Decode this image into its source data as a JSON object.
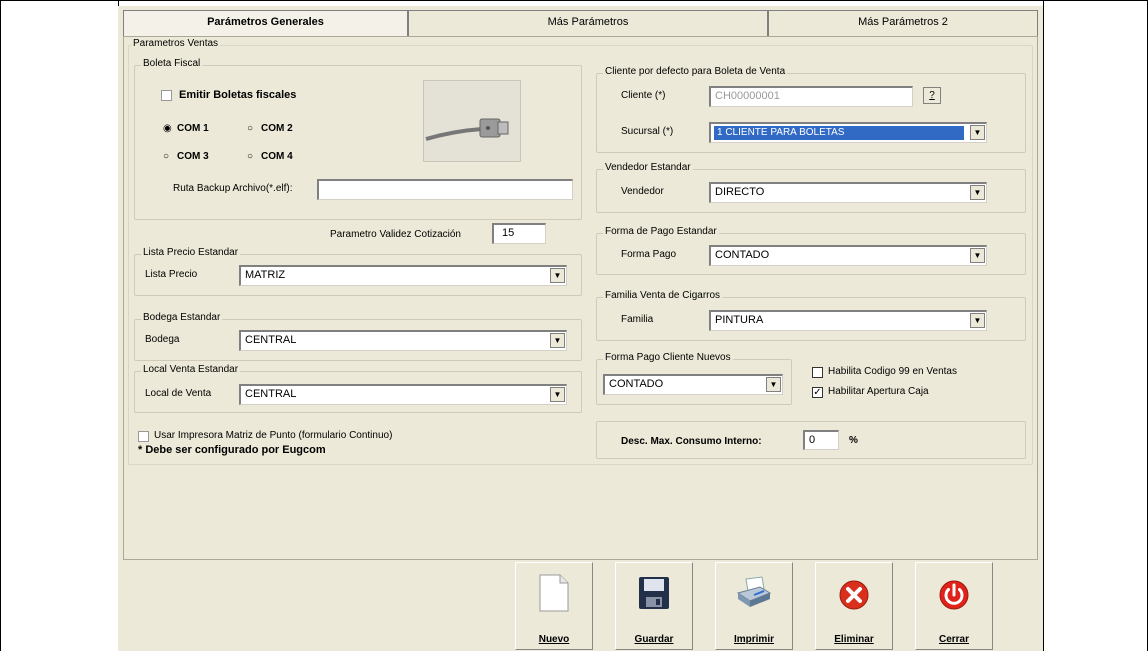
{
  "tabs": [
    {
      "label": "Parámetros Generales",
      "active": true
    },
    {
      "label": "Más Parámetros",
      "active": false
    },
    {
      "label": "Más Parámetros 2",
      "active": false
    }
  ],
  "parametros_ventas": {
    "legend": "Parametros Ventas",
    "boleta_fiscal": {
      "legend": "Boleta Fiscal",
      "emitir_label": "Emitir Boletas fiscales",
      "emitir_checked": false,
      "ports": [
        {
          "label": "COM 1",
          "selected": true
        },
        {
          "label": "COM 2",
          "selected": false
        },
        {
          "label": "COM 3",
          "selected": false
        },
        {
          "label": "COM 4",
          "selected": false
        }
      ],
      "ruta_label": "Ruta Backup Archivo(*.elf):",
      "ruta_value": ""
    },
    "validez_label": "Parametro Validez Cotización",
    "validez_value": "15",
    "lista_precio": {
      "legend": "Lista Precio Estandar",
      "label": "Lista Precio",
      "value": "MATRIZ"
    },
    "bodega": {
      "legend": "Bodega Estandar",
      "label": "Bodega",
      "value": "CENTRAL"
    },
    "local_venta": {
      "legend": "Local Venta Estandar",
      "label": "Local de Venta",
      "value": "CENTRAL"
    },
    "impresora_label": "Usar Impresora Matriz de Punto (formulario Continuo)",
    "impresora_checked": false,
    "eugcom_note": "* Debe ser configurado por Eugcom"
  },
  "cliente_defecto": {
    "legend": "Cliente por defecto para Boleta de Venta",
    "cliente_label": "Cliente (*)",
    "cliente_value": "CH00000001",
    "help_button": "?",
    "sucursal_label": "Sucursal (*)",
    "sucursal_value": "1 CLIENTE PARA BOLETAS"
  },
  "vendedor": {
    "legend": "Vendedor Estandar",
    "label": "Vendedor",
    "value": "DIRECTO"
  },
  "forma_pago": {
    "legend": "Forma de Pago Estandar",
    "label": "Forma Pago",
    "value": "CONTADO"
  },
  "familia": {
    "legend": "Familia Venta de Cigarros",
    "label": "Familia",
    "value": "PINTURA"
  },
  "forma_pago_nuevos": {
    "legend": "Forma Pago Cliente Nuevos",
    "value": "CONTADO"
  },
  "habilita_codigo_label": "Habilita Codigo 99 en Ventas",
  "habilita_codigo_checked": false,
  "habilitar_apertura_label": "Habilitar Apertura Caja",
  "habilitar_apertura_checked": true,
  "desc_label": "Desc. Max. Consumo Interno:",
  "desc_value": "0",
  "desc_unit": "%",
  "toolbar": {
    "nuevo": "Nuevo",
    "guardar": "Guardar",
    "imprimir": "Imprimir",
    "eliminar": "Eliminar",
    "cerrar": "Cerrar"
  },
  "colors": {
    "window_bg": "#ece9d8",
    "selection": "#316ac5",
    "delete_red": "#d9301e",
    "close_red": "#e0221a"
  }
}
